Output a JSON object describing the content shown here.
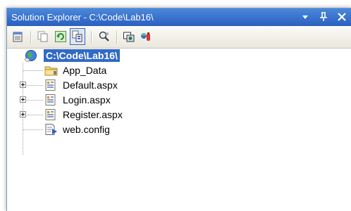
{
  "window": {
    "title": "Solution Explorer - C:\\Code\\Lab16\\",
    "buttons": [
      {
        "name": "dropdown-arrow",
        "glyph": "▼"
      },
      {
        "name": "pin",
        "glyph": "⊥"
      },
      {
        "name": "close",
        "glyph": "✕"
      }
    ]
  },
  "toolbar": {
    "icons": [
      "properties-icon",
      "copy-icon",
      "refresh-icon",
      "show-all-files-icon",
      "view-designer-icon",
      "copy-website-icon",
      "aspnet-configuration-icon"
    ],
    "pressed": "show-all-files-icon"
  },
  "tree": {
    "root": {
      "label": "C:\\Code\\Lab16\\",
      "icon": "website-globe-icon",
      "selected": true
    },
    "items": [
      {
        "label": "App_Data",
        "icon": "folder-icon",
        "expandable": false
      },
      {
        "label": "Default.aspx",
        "icon": "aspx-page-icon",
        "expandable": true
      },
      {
        "label": "Login.aspx",
        "icon": "aspx-page-icon",
        "expandable": true
      },
      {
        "label": "Register.aspx",
        "icon": "aspx-page-icon",
        "expandable": true
      },
      {
        "label": "web.config",
        "icon": "config-file-icon",
        "expandable": false
      }
    ]
  },
  "colors": {
    "title_bar": "#2b5fbf",
    "selection": "#316ac5"
  }
}
